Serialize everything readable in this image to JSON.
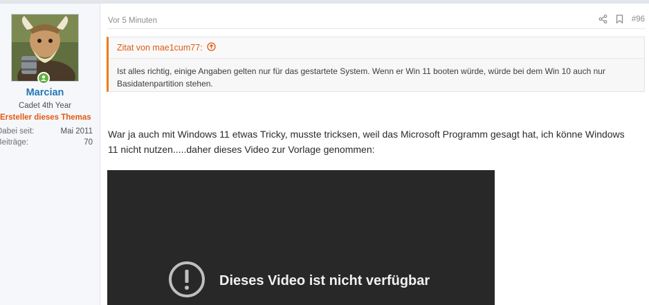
{
  "user": {
    "name": "Marcian",
    "title": "Cadet 4th Year",
    "starter_badge": "Ersteller dieses Themas",
    "stats": [
      {
        "label": "Dabei seit:",
        "value": "Mai 2011"
      },
      {
        "label": "Beiträge:",
        "value": "70"
      }
    ]
  },
  "post": {
    "time": "Vor 5 Minuten",
    "number": "#96",
    "quote": {
      "attribution": "Zitat von mae1cum77:",
      "text": "Ist alles richtig, einige Angaben gelten nur für das gestartete System. Wenn er Win 11 booten würde, würde bei dem Win 10 auch nur Basidatenpartition stehen."
    },
    "message": "War ja auch mit Windows 11 etwas Tricky, musste tricksen, weil das Microsoft Programm gesagt hat, ich könne Windows 11 nicht nutzen.....daher dieses Video zur Vorlage genommen:",
    "video_error": "Dieses Video ist nicht verfügbar"
  },
  "colors": {
    "accent": "#e05a12",
    "username": "#2577b1",
    "online": "#63b140",
    "video_bg": "#282828"
  },
  "icons": [
    "share-icon",
    "bookmark-icon",
    "quote-jump-icon",
    "online-status-icon",
    "video-unavailable-icon"
  ]
}
